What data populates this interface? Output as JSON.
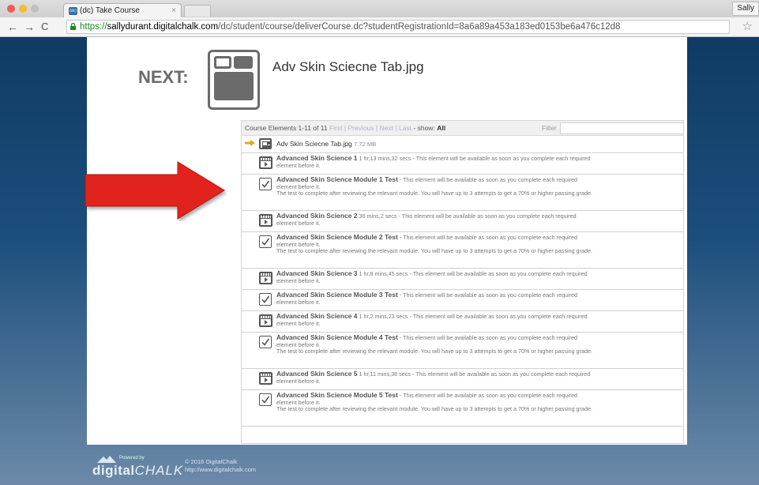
{
  "browser": {
    "tab_label": "(dc) Take Course",
    "favicon_text": "(dc)",
    "tab_close": "×",
    "profile": "Sally",
    "url_https": "https://",
    "url_domain": "sallydurant.digitalchalk.com",
    "url_path": "/dc/student/course/deliverCourse.dc?studentRegistrationId=8a6a89a453a183ed0153be6a476c12d8"
  },
  "next": {
    "label": "NEXT:",
    "title": "Adv Skin Sciecne Tab.jpg"
  },
  "list": {
    "header_prefix": "Course Elements 1-11 of 11",
    "nav_links": [
      "First",
      "Previous",
      "Next",
      "Last"
    ],
    "show_prefix": "- show:",
    "show_value": "All",
    "filter_label": "Filter",
    "current": {
      "name": "Adv Skin Sciecne Tab.jpg",
      "size": "7.72 MB"
    },
    "items": [
      {
        "type": "video",
        "title": "Advanced Skin Science 1",
        "desc": "1 hr,13 mins,32 secs - This element will be available as soon as you complete each required element before it."
      },
      {
        "type": "test",
        "title": "Advanced Skin Science Module 1 Test",
        "desc": "- This element will be available as soon as you complete each required element before it.",
        "note": "The test to complete after reviewing the relevant module. You will have up to 3 attempts to get a 70% or higher passing grade."
      },
      {
        "type": "video",
        "title": "Advanced Skin Science 2",
        "desc": "36 mins,2 secs - This element will be available as soon as you complete each required element before it."
      },
      {
        "type": "test",
        "title": "Advanced Skin Science Module 2 Test",
        "desc": "- This element will be available as soon as you complete each required element before it.",
        "note": "The test to complete after reviewing the relevant module. You will have up to 3 attempts to get a 70% or higher passing grade."
      },
      {
        "type": "video",
        "title": "Advanced Skin Science 3",
        "desc": "1 hr,8 mins,45 secs - This element will be available as soon as you complete each required element before it."
      },
      {
        "type": "test",
        "title": "Advanced Skin Science Module 3 Test",
        "desc": "- This element will be available as soon as you complete each required element before it."
      },
      {
        "type": "video",
        "title": "Advanced Skin Science 4",
        "desc": "1 hr,2 mins,23 secs - This element will be available as soon as you complete each required element before it."
      },
      {
        "type": "test",
        "title": "Advanced Skin Science Module 4 Test",
        "desc": "- This element will be available as soon as you complete each required element before it.",
        "note": "The test to complete after reviewing the relevant module. You will have up to 3 attempts to get a 70% or higher passing grade."
      },
      {
        "type": "video",
        "title": "Advanced Skin Science 5",
        "desc": "1 hr,11 mins,38 secs - This element will be available as soon as you complete each required element before it."
      },
      {
        "type": "test",
        "title": "Advanced Skin Science Module 5 Test",
        "desc": "- This element will be available as soon as you complete each required element before it.",
        "note": "The test to complete after reviewing the relevant module. You will have up to 3 attempts to get a 70% or higher passing grade."
      }
    ]
  },
  "footer": {
    "powered_by": "Powered by",
    "logo_a": "digital",
    "logo_b": "CHALK",
    "copyright": "© 2016 DigitalChalk",
    "url": "http://www.digitalchalk.com"
  },
  "colors": {
    "current_arrow": "#e0a81f",
    "big_arrow": "#e2231a"
  }
}
